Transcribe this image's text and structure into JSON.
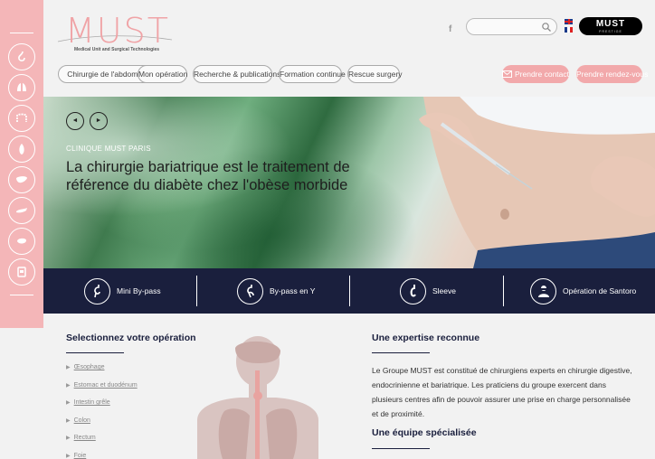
{
  "logo": {
    "name": "MUST",
    "subtitle": "Medical Unit and Surgical Technologies"
  },
  "header": {
    "facebook": "f",
    "search_placeholder": "",
    "must_button": {
      "title": "MUST",
      "tagline": "PRESTIGE"
    }
  },
  "nav": {
    "items": [
      "Chirurgie de l'abdomen",
      "Mon opération",
      "Recherche & publications",
      "Formation continue",
      "Rescue surgery"
    ],
    "contact": "Prendre contact",
    "appointment": "Prendre rendez-vous"
  },
  "hero": {
    "kicker": "CLINIQUE MUST PARIS",
    "title": "La chirurgie bariatrique est le traitement de référence du diabète chez l'obèse morbide",
    "prev": "◄",
    "next": "►"
  },
  "strip": {
    "items": [
      "Mini By-pass",
      "By-pass en Y",
      "Sleeve",
      "Opération de Santoro"
    ]
  },
  "select_section": {
    "title": "Selectionnez votre opération",
    "items": [
      "Œsophage",
      "Estomac et duodénum",
      "Intestin grêle",
      "Colon",
      "Rectum",
      "Foie"
    ]
  },
  "expertise": {
    "title": "Une expertise reconnue",
    "text": "Le Groupe MUST est constitué de chirurgiens experts en chirurgie digestive, endocrinienne et bariatrique. Les praticiens du groupe exercent dans plusieurs centres afin de pouvoir assurer une prise en charge personnalisée et de proximité."
  },
  "team": {
    "title": "Une équipe spécialisée"
  },
  "colors": {
    "pink": "#f4b6b8",
    "navy": "#1a1f3d",
    "accent": "#f2a9ab"
  }
}
